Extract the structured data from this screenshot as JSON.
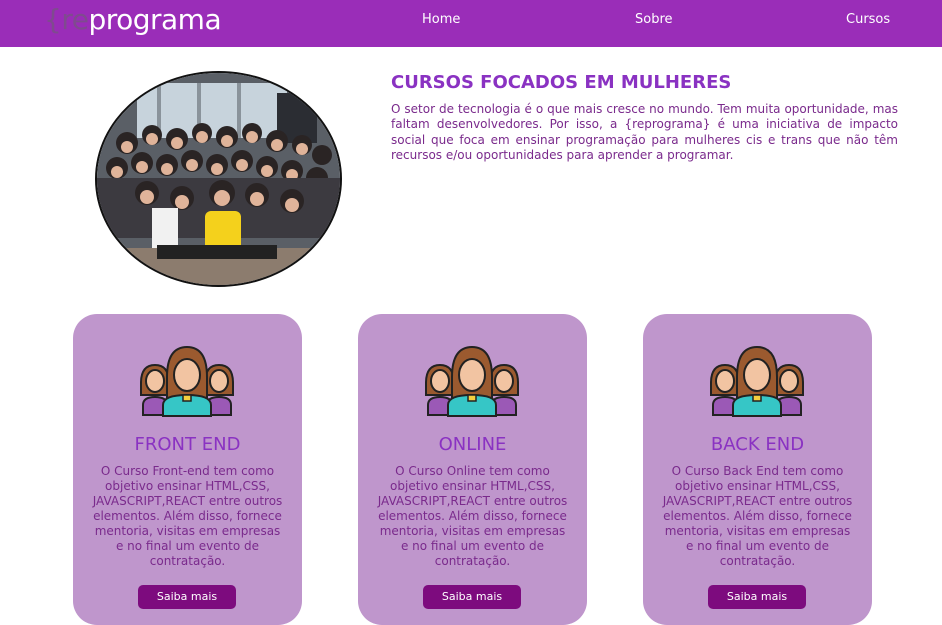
{
  "header": {
    "logo_prefix": "{re",
    "logo_main": "programa",
    "nav": {
      "home": "Home",
      "sobre": "Sobre",
      "cursos": "Cursos"
    }
  },
  "hero": {
    "title": "CURSOS FOCADOS EM MULHERES",
    "text": "O setor de tecnologia é o que mais cresce no mundo. Tem muita oportunidade, mas faltam desenvolvedores. Por isso, a {reprograma} é uma iniciativa de impacto social que foca em ensinar programação para mulheres cis e trans que não têm recursos e/ou oportunidades para aprender a programar.",
    "photo": "group-photo"
  },
  "cards": [
    {
      "title": "FRONT END",
      "text": "O Curso Front-end tem como objetivo ensinar HTML,CSS, JAVASCRIPT,REACT entre outros elementos. Além disso, fornece mentoria, visitas em empresas e no final um evento de contratação.",
      "button": "Saiba mais",
      "icon": "women-group-icon"
    },
    {
      "title": "ONLINE",
      "text": "O Curso Online tem como objetivo ensinar HTML,CSS, JAVASCRIPT,REACT entre outros elementos. Além disso, fornece mentoria, visitas em empresas e no final um evento de contratação.",
      "button": "Saiba mais",
      "icon": "women-group-icon"
    },
    {
      "title": "BACK END",
      "text": "O Curso Back End tem como objetivo ensinar HTML,CSS, JAVASCRIPT,REACT entre outros elementos. Além disso, fornece mentoria, visitas em empresas e no final um evento de contratação.",
      "button": "Saiba mais",
      "icon": "women-group-icon"
    }
  ],
  "colors": {
    "header_bg": "#9a2db8",
    "card_bg": "#bf96cc",
    "title": "#8a32c2",
    "text": "#7a2a8c",
    "button": "#7d0b7e"
  }
}
